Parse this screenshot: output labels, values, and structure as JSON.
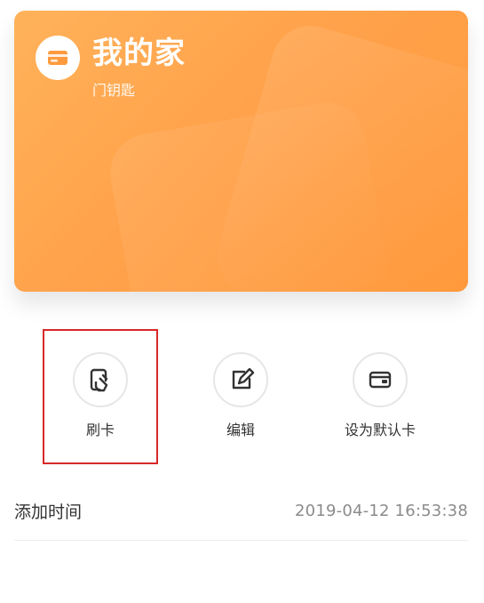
{
  "card": {
    "title": "我的家",
    "subtitle": "门钥匙",
    "icon": "card-icon",
    "colors": {
      "primary": "#ffa24b",
      "text": "#ffffff"
    }
  },
  "actions": [
    {
      "label": "刷卡",
      "icon": "tap-card-icon"
    },
    {
      "label": "编辑",
      "icon": "edit-icon"
    },
    {
      "label": "设为默认卡",
      "icon": "default-card-icon"
    }
  ],
  "info": {
    "label": "添加时间",
    "value": "2019-04-12 16:53:38"
  },
  "highlight": {
    "color": "#d8282a"
  }
}
